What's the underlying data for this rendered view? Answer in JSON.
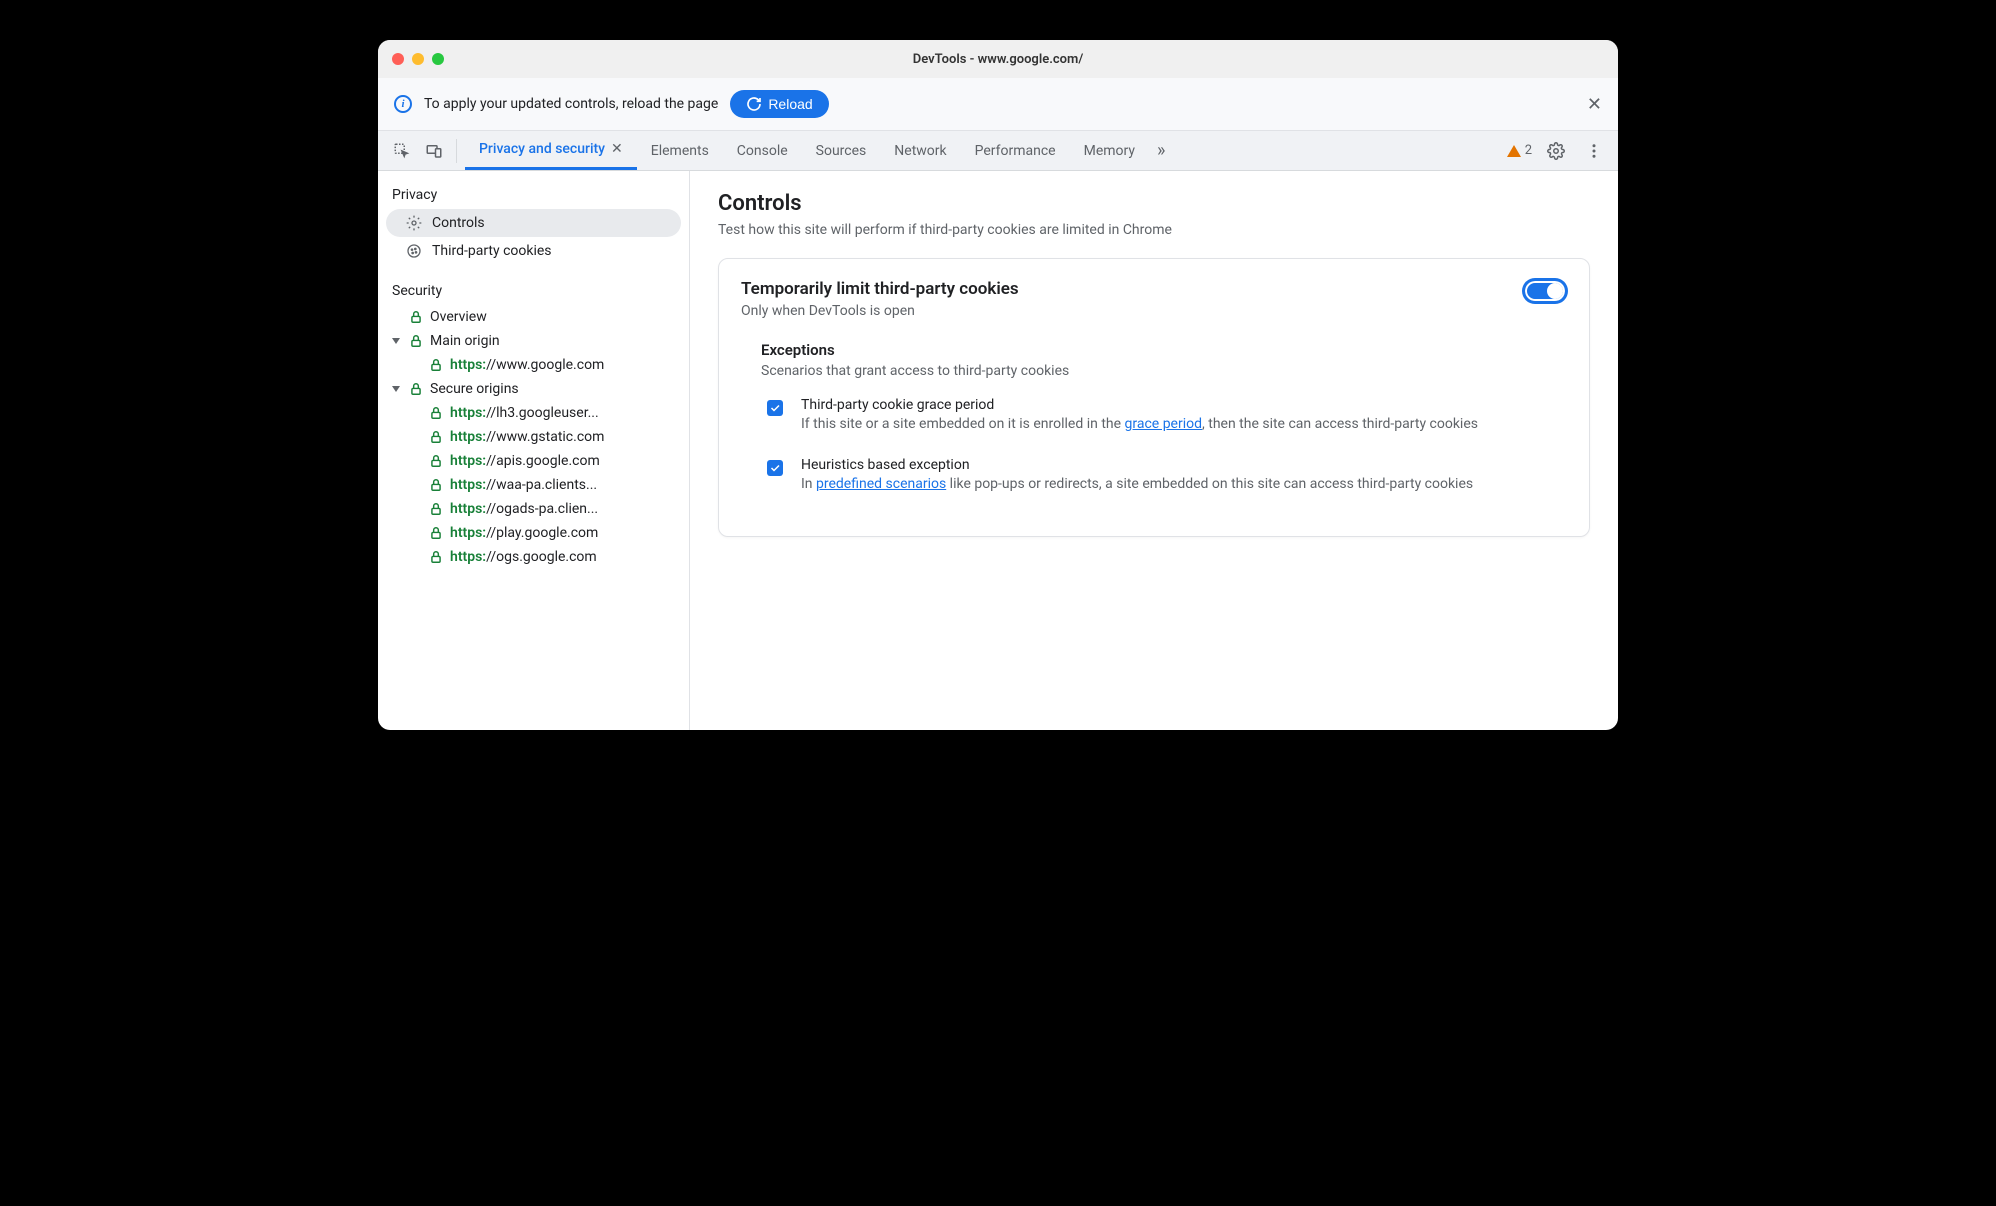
{
  "window": {
    "title": "DevTools - www.google.com/"
  },
  "notice": {
    "text": "To apply your updated controls, reload the page",
    "button": "Reload"
  },
  "tabs": {
    "active": "Privacy and security",
    "items": [
      "Elements",
      "Console",
      "Sources",
      "Network",
      "Performance",
      "Memory"
    ]
  },
  "toolbar": {
    "warning_count": "2"
  },
  "sidebar": {
    "privacy": {
      "header": "Privacy",
      "items": [
        {
          "label": "Controls",
          "icon": "gear"
        },
        {
          "label": "Third-party cookies",
          "icon": "cookie"
        }
      ]
    },
    "security": {
      "header": "Security",
      "overview": "Overview",
      "main_origin": {
        "label": "Main origin",
        "origins": [
          {
            "scheme": "https:",
            "rest": "//www.google.com"
          }
        ]
      },
      "secure_origins": {
        "label": "Secure origins",
        "origins": [
          {
            "scheme": "https:",
            "rest": "//lh3.googleuser..."
          },
          {
            "scheme": "https:",
            "rest": "//www.gstatic.com"
          },
          {
            "scheme": "https:",
            "rest": "//apis.google.com"
          },
          {
            "scheme": "https:",
            "rest": "//waa-pa.clients..."
          },
          {
            "scheme": "https:",
            "rest": "//ogads-pa.clien..."
          },
          {
            "scheme": "https:",
            "rest": "//play.google.com"
          },
          {
            "scheme": "https:",
            "rest": "//ogs.google.com"
          }
        ]
      }
    }
  },
  "main": {
    "title": "Controls",
    "subtitle": "Test how this site will perform if third-party cookies are limited in Chrome",
    "card": {
      "title": "Temporarily limit third-party cookies",
      "subtitle": "Only when DevTools is open",
      "toggle_on": true,
      "exceptions": {
        "header": "Exceptions",
        "subheader": "Scenarios that grant access to third-party cookies",
        "items": [
          {
            "title": "Third-party cookie grace period",
            "desc_pre": "If this site or a site embedded on it is enrolled in the ",
            "link": "grace period",
            "desc_post": ", then the site can access third-party cookies"
          },
          {
            "title": "Heuristics based exception",
            "desc_pre": "In ",
            "link": "predefined scenarios",
            "desc_post": " like pop-ups or redirects, a site embedded on this site can access third-party cookies"
          }
        ]
      }
    }
  }
}
